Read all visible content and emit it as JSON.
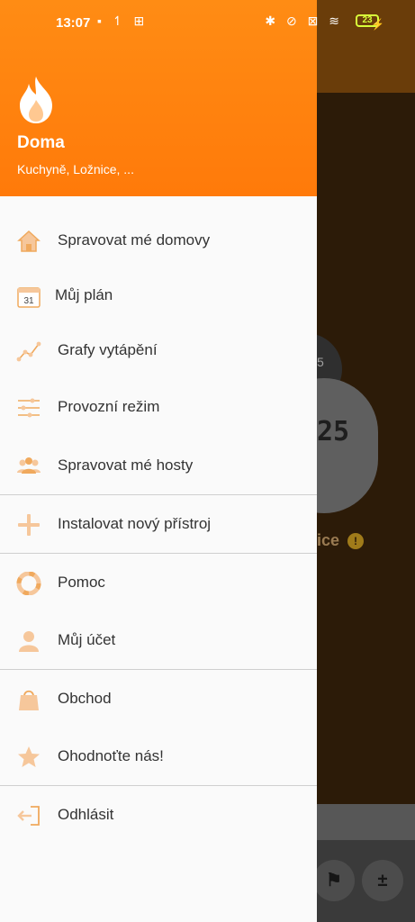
{
  "status_bar": {
    "time": "13:07",
    "battery": "23"
  },
  "drawer": {
    "home_name": "Doma",
    "home_rooms": "Kuchyně, Ložnice, ...",
    "menu": [
      {
        "label": "Spravovat mé domovy",
        "icon": "home-icon"
      },
      {
        "label": "Můj plán",
        "icon": "calendar-icon"
      },
      {
        "label": "Grafy vytápění",
        "icon": "chart-icon"
      },
      {
        "label": "Provozní režim",
        "icon": "sliders-icon"
      },
      {
        "label": "Spravovat mé hosty",
        "icon": "group-icon"
      },
      {
        "label": "Instalovat nový přístroj",
        "icon": "plus-icon"
      },
      {
        "label": "Pomoc",
        "icon": "lifebuoy-icon"
      },
      {
        "label": "Můj účet",
        "icon": "user-icon"
      },
      {
        "label": "Obchod",
        "icon": "shopping-bag-icon"
      },
      {
        "label": "Ohodnoťte nás!",
        "icon": "star-icon"
      },
      {
        "label": "Odhlásit",
        "icon": "logout-icon"
      }
    ],
    "calendar_day": "31"
  },
  "background": {
    "digits": "25",
    "small": "5",
    "label": "ice",
    "info": "!"
  },
  "colors": {
    "accent": "#ff8410",
    "icon": "#f3b67a",
    "text": "#333333"
  }
}
